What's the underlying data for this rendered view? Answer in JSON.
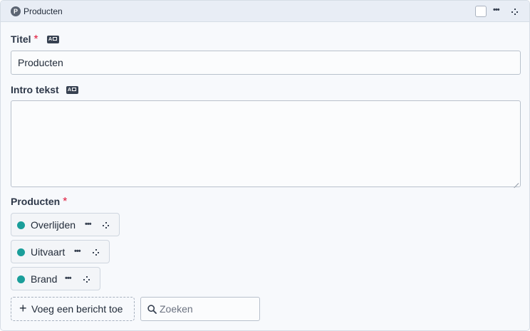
{
  "header": {
    "badge_letter": "P",
    "title": "Producten"
  },
  "fields": {
    "titel": {
      "label": "Titel",
      "required_mark": "*",
      "value": "Producten"
    },
    "intro": {
      "label": "Intro tekst",
      "value": ""
    },
    "producten": {
      "label": "Producten",
      "required_mark": "*",
      "items": [
        {
          "label": "Overlijden",
          "color": "#1a9e9a"
        },
        {
          "label": "Uitvaart",
          "color": "#1a9e9a"
        },
        {
          "label": "Brand",
          "color": "#1a9e9a"
        }
      ]
    }
  },
  "actions": {
    "add_plus": "+",
    "add_label": "Voeg een bericht toe",
    "search_placeholder": "Zoeken"
  },
  "icons": {
    "locale": "locale-icon",
    "more": "more-dots-icon",
    "move": "drag-handle-icon",
    "search": "search-icon"
  }
}
